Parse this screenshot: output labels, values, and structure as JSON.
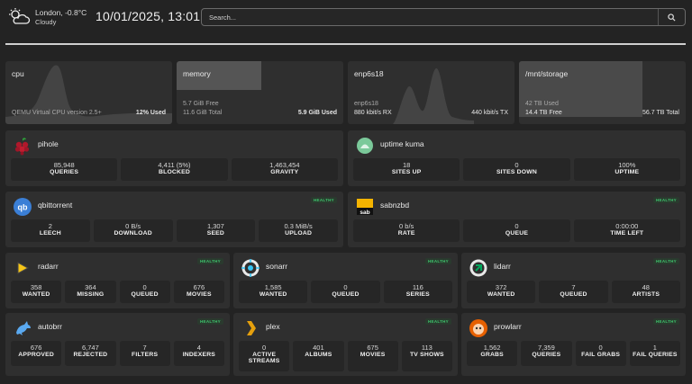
{
  "header": {
    "location": "London, -0.8°C",
    "condition": "Cloudy",
    "datetime": "10/01/2025, 13:01",
    "search_placeholder": "Search..."
  },
  "resources": [
    {
      "name": "cpu",
      "line1_left": "QEMU Virtual CPU version 2.5+",
      "line1_right": "12% Used"
    },
    {
      "name": "memory",
      "line1_left": "5.7 GiB Free",
      "line2_left": "11.6 GiB Total",
      "line2_right": "5.9 GiB Used",
      "fill_fraction": 0.51
    },
    {
      "name": "enp6s18",
      "line1_left": "enp6s18",
      "line2_left": "880 kbit/s RX",
      "line2_right": "440 kbit/s TX"
    },
    {
      "name": "/mnt/storage",
      "line1_left": "42 TB Used",
      "line2_left": "14.4 TB Free",
      "line2_right": "56.7 TB Total",
      "fill_fraction": 0.74
    }
  ],
  "services": {
    "pihole": {
      "title": "pihole",
      "stats": [
        {
          "v": "85,948",
          "k": "QUERIES"
        },
        {
          "v": "4,411 (5%)",
          "k": "BLOCKED"
        },
        {
          "v": "1,463,454",
          "k": "GRAVITY"
        }
      ]
    },
    "uptime": {
      "title": "uptime kuma",
      "stats": [
        {
          "v": "18",
          "k": "SITES UP"
        },
        {
          "v": "0",
          "k": "SITES DOWN"
        },
        {
          "v": "100%",
          "k": "UPTIME"
        }
      ]
    },
    "qbit": {
      "title": "qbittorrent",
      "badge": "HEALTHY",
      "stats": [
        {
          "v": "2",
          "k": "LEECH"
        },
        {
          "v": "0 B/s",
          "k": "DOWNLOAD"
        },
        {
          "v": "1,307",
          "k": "SEED"
        },
        {
          "v": "0.3 MiB/s",
          "k": "UPLOAD"
        }
      ]
    },
    "sab": {
      "title": "sabnzbd",
      "badge": "HEALTHY",
      "stats": [
        {
          "v": "0 b/s",
          "k": "RATE"
        },
        {
          "v": "0",
          "k": "QUEUE"
        },
        {
          "v": "0:00:00",
          "k": "TIME LEFT"
        }
      ]
    },
    "radarr": {
      "title": "radarr",
      "badge": "HEALTHY",
      "stats": [
        {
          "v": "358",
          "k": "WANTED"
        },
        {
          "v": "364",
          "k": "MISSING"
        },
        {
          "v": "0",
          "k": "QUEUED"
        },
        {
          "v": "676",
          "k": "MOVIES"
        }
      ]
    },
    "sonarr": {
      "title": "sonarr",
      "badge": "HEALTHY",
      "stats": [
        {
          "v": "1,585",
          "k": "WANTED"
        },
        {
          "v": "0",
          "k": "QUEUED"
        },
        {
          "v": "116",
          "k": "SERIES"
        }
      ]
    },
    "lidarr": {
      "title": "lidarr",
      "badge": "HEALTHY",
      "stats": [
        {
          "v": "372",
          "k": "WANTED"
        },
        {
          "v": "7",
          "k": "QUEUED"
        },
        {
          "v": "48",
          "k": "ARTISTS"
        }
      ]
    },
    "autobrr": {
      "title": "autobrr",
      "badge": "HEALTHY",
      "stats": [
        {
          "v": "676",
          "k": "APPROVED"
        },
        {
          "v": "6,747",
          "k": "REJECTED"
        },
        {
          "v": "7",
          "k": "FILTERS"
        },
        {
          "v": "4",
          "k": "INDEXERS"
        }
      ]
    },
    "plex": {
      "title": "plex",
      "badge": "HEALTHY",
      "stats": [
        {
          "v": "0",
          "k": "ACTIVE STREAMS"
        },
        {
          "v": "401",
          "k": "ALBUMS"
        },
        {
          "v": "675",
          "k": "MOVIES"
        },
        {
          "v": "113",
          "k": "TV SHOWS"
        }
      ]
    },
    "prowlarr": {
      "title": "prowlarr",
      "badge": "HEALTHY",
      "stats": [
        {
          "v": "1,562",
          "k": "GRABS"
        },
        {
          "v": "7,359",
          "k": "QUERIES"
        },
        {
          "v": "0",
          "k": "FAIL GRABS"
        },
        {
          "v": "1",
          "k": "FAIL QUERIES"
        }
      ]
    }
  },
  "icons": {
    "weather": "partly-cloudy-icon",
    "search": "search-icon"
  },
  "colors": {
    "healthy": "#3ec46d",
    "background": "#232323",
    "card": "#2f2f2f"
  }
}
